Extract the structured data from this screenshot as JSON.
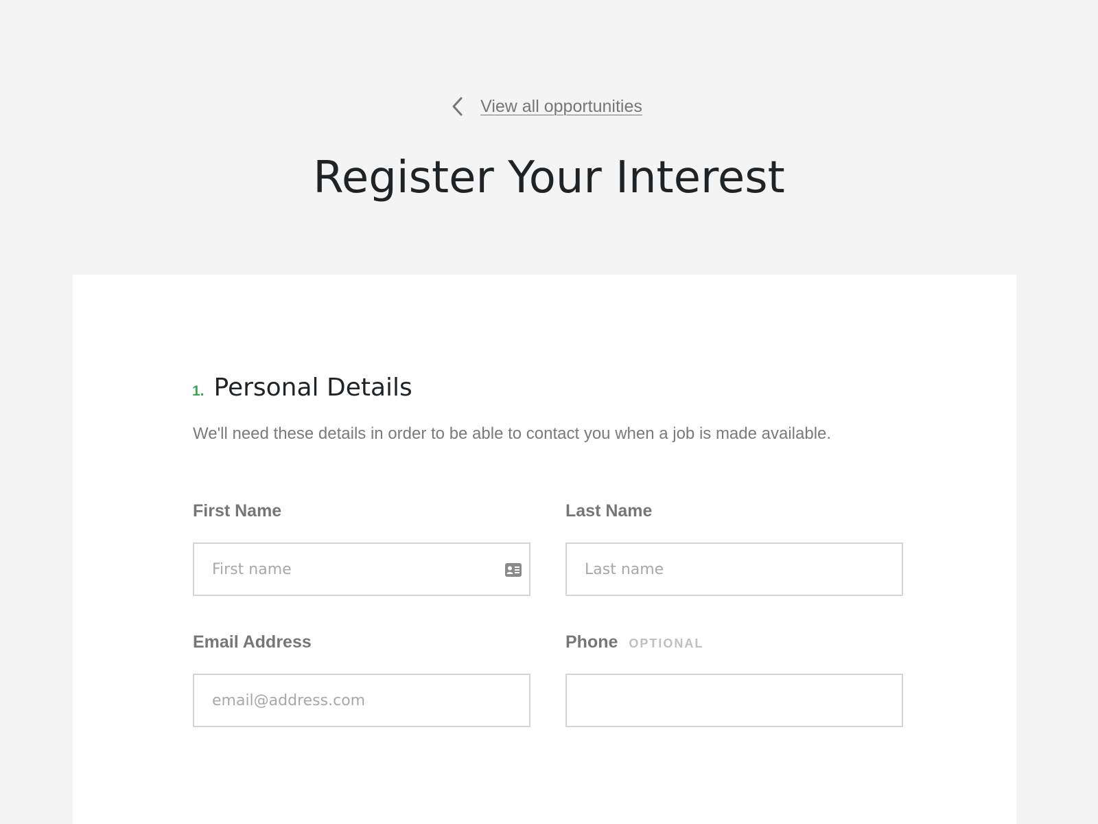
{
  "header": {
    "back_link_label": "View all opportunities",
    "title": "Register Your Interest"
  },
  "section": {
    "number": "1.",
    "title": "Personal Details",
    "description": "We'll need these details in order to be able to contact you when a job is made available."
  },
  "fields": {
    "first_name": {
      "label": "First Name",
      "placeholder": "First name",
      "value": ""
    },
    "last_name": {
      "label": "Last Name",
      "placeholder": "Last name",
      "value": ""
    },
    "email": {
      "label": "Email Address",
      "placeholder": "email@address.com",
      "value": ""
    },
    "phone": {
      "label": "Phone",
      "optional_tag": "OPTIONAL",
      "placeholder": "",
      "value": ""
    }
  },
  "icons": {
    "back": "chevron-left-icon",
    "autofill": "contact-card-icon"
  },
  "colors": {
    "page_background": "#f4f4f4",
    "card_background": "#ffffff",
    "accent_green": "#39a557",
    "title_text": "#1f2326",
    "muted_text": "#767676",
    "input_border": "#d4d4d4"
  }
}
